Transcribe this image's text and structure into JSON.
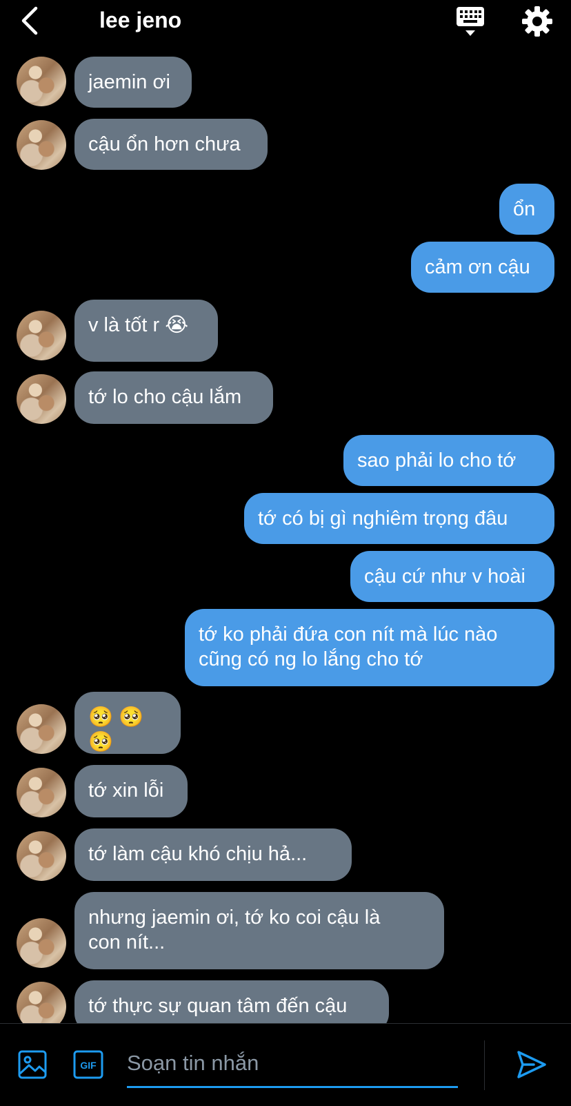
{
  "header": {
    "title": "lee jeno",
    "back_icon": "chevron-left-icon",
    "keyboard_icon": "keyboard-icon",
    "settings_icon": "gear-icon"
  },
  "messages": [
    {
      "text": "jaemin ơi"
    },
    {
      "text": "cậu ổn hơn chưa"
    },
    {
      "text": "ổn"
    },
    {
      "text": "cảm ơn cậu"
    },
    {
      "text": "v là tốt r 😭"
    },
    {
      "text": "tớ lo cho cậu lắm"
    },
    {
      "text": "sao phải lo cho tớ"
    },
    {
      "text": "tớ có bị gì nghiêm trọng đâu"
    },
    {
      "text": "cậu cứ như v hoài"
    },
    {
      "text": "tớ ko phải đứa con nít mà lúc nào\ncũng có ng lo lắng cho tớ"
    },
    {
      "text": "🥺 🥺 🥺"
    },
    {
      "text": "tớ xin lỗi"
    },
    {
      "text": "tớ làm cậu khó chịu hả..."
    },
    {
      "text": "nhưng jaemin ơi, tớ ko coi cậu là\ncon nít..."
    },
    {
      "text": "tớ thực sự quan tâm đến cậu"
    }
  ],
  "composer": {
    "placeholder": "Soạn tin nhắn",
    "value": "",
    "image_icon": "image-icon",
    "gif_label": "GIF",
    "send_icon": "send-icon"
  },
  "colors": {
    "background": "#000000",
    "incoming_bubble": "#687684",
    "outgoing_bubble": "#4a9be7",
    "accent": "#1d9bf0"
  }
}
